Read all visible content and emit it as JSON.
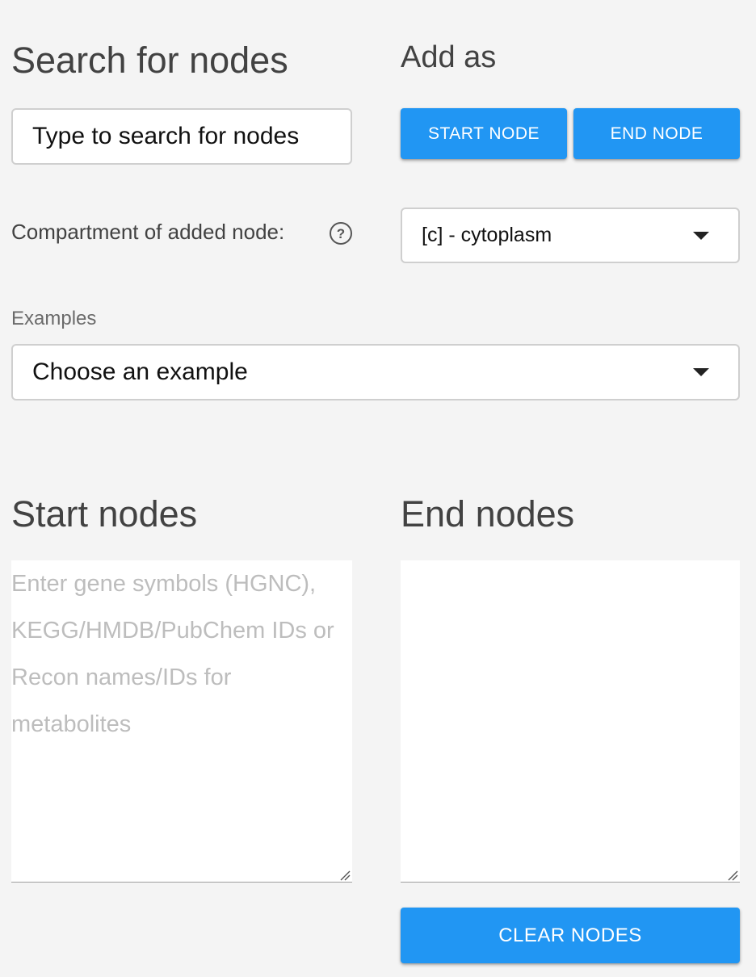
{
  "search": {
    "title": "Search for nodes",
    "placeholder": "Type to search for nodes"
  },
  "add_as": {
    "title": "Add as",
    "start_button": "START NODE",
    "end_button": "END NODE"
  },
  "compartment": {
    "label": "Compartment of added node:",
    "help_icon": "question-circle-icon",
    "selected": "[c] - cytoplasm"
  },
  "examples": {
    "label": "Examples",
    "selected": "Choose an example"
  },
  "start_nodes": {
    "title": "Start nodes",
    "placeholder": "Enter gene symbols (HGNC), KEGG/HMDB/PubChem IDs or Recon names/IDs for metabolites",
    "value": ""
  },
  "end_nodes": {
    "title": "End nodes",
    "value": ""
  },
  "clear_button": "CLEAR NODES",
  "colors": {
    "accent": "#2196f3",
    "background": "#f4f4f4"
  }
}
